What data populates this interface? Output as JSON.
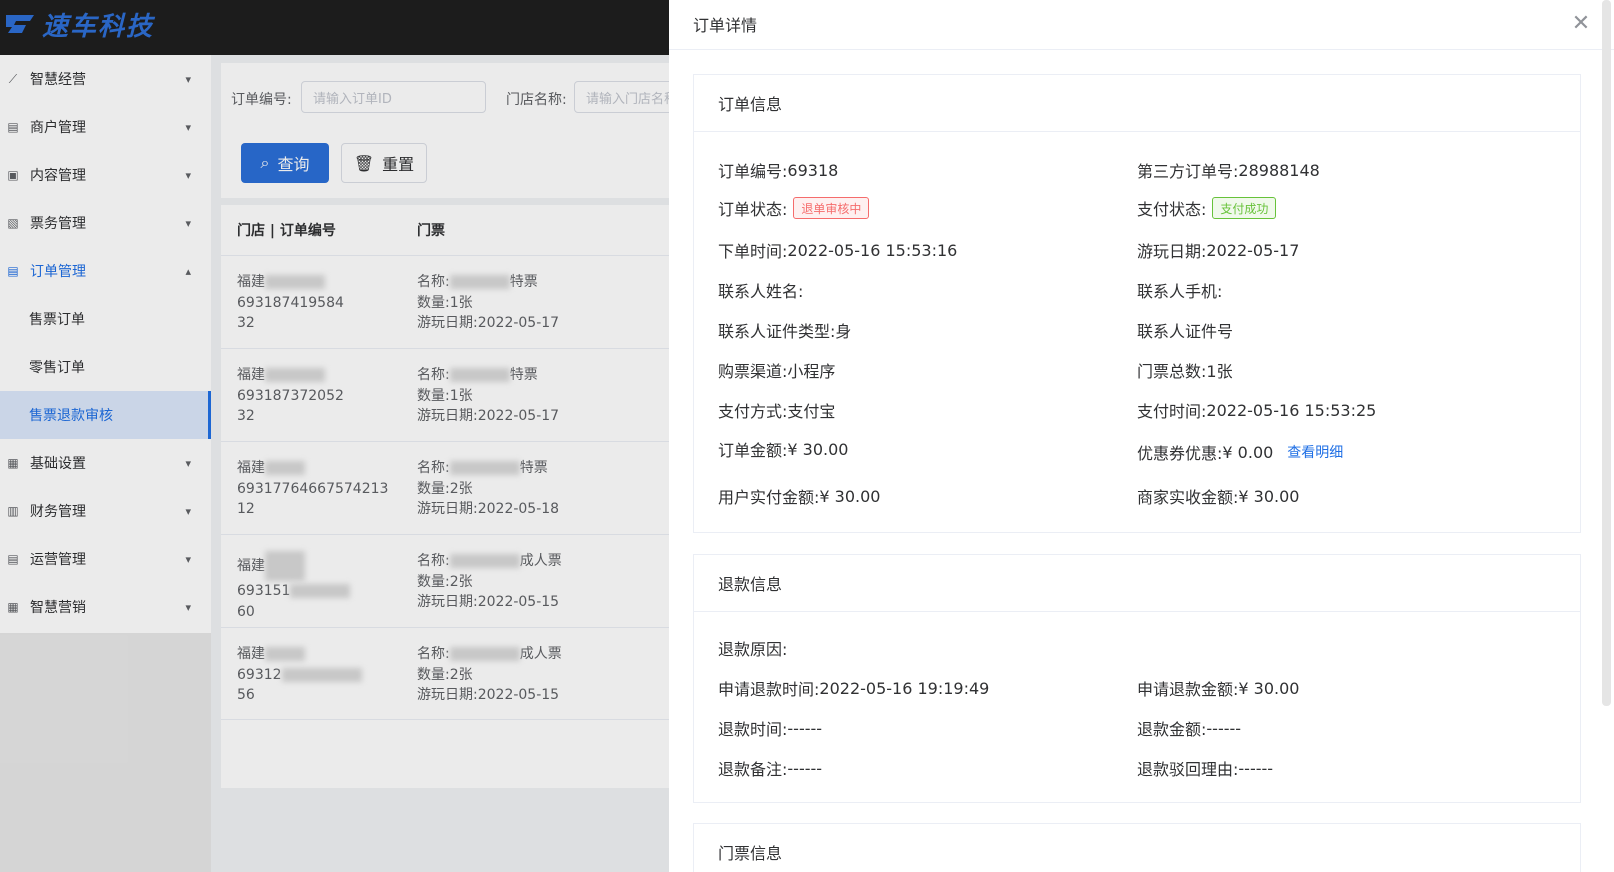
{
  "brand": {
    "logo_text": "速车科技"
  },
  "sidebar": {
    "items": [
      {
        "label": "智慧经营",
        "icon": "chart-line-icon",
        "chevron": "⌄"
      },
      {
        "label": "商户管理",
        "icon": "list-icon",
        "chevron": "⌄"
      },
      {
        "label": "内容管理",
        "icon": "document-icon",
        "chevron": "⌄"
      },
      {
        "label": "票务管理",
        "icon": "ticket-icon",
        "chevron": "⌄"
      },
      {
        "label": "订单管理",
        "icon": "order-icon",
        "chevron": "⌃"
      }
    ],
    "sub_items": [
      "售票订单",
      "零售订单",
      "售票退款审核"
    ],
    "items_after": [
      {
        "label": "基础设置",
        "icon": "settings-icon"
      },
      {
        "label": "财务管理",
        "icon": "bar-chart-icon"
      },
      {
        "label": "运营管理",
        "icon": "clipboard-icon"
      },
      {
        "label": "智慧营销",
        "icon": "grid-icon"
      }
    ]
  },
  "filters": {
    "order_no_label": "订单编号:",
    "order_no_placeholder": "请输入订单ID",
    "store_label": "门店名称:",
    "store_placeholder": "请输入门店名称",
    "query_button": "查询",
    "reset_button": "重置"
  },
  "table": {
    "headers": [
      "门店 | 订单编号",
      "门票"
    ],
    "rows": [
      {
        "store": "福建",
        "order_no_line1": "693187419584",
        "order_no_line2": "32",
        "name": "名称:",
        "name_suffix": "特票",
        "qty": "数量:1张",
        "date": "游玩日期:2022-05-17"
      },
      {
        "store": "福建",
        "order_no_line1": "693187372052",
        "order_no_line2": "32",
        "name": "名称:",
        "name_suffix": "特票",
        "qty": "数量:1张",
        "date": "游玩日期:2022-05-17"
      },
      {
        "store": "福建",
        "order_no_line1": "69317764667574213",
        "order_no_line2": "12",
        "name": "名称:",
        "name_suffix": "特票",
        "qty": "数量:2张",
        "date": "游玩日期:2022-05-18"
      },
      {
        "store": "福建",
        "order_no_line1": "693151",
        "order_no_line2": "60",
        "name": "名称:",
        "name_suffix": "成人票",
        "qty": "数量:2张",
        "date": "游玩日期:2022-05-15"
      },
      {
        "store": "福建",
        "order_no_line1": "69312",
        "order_no_line2": "56",
        "name": "名称:",
        "name_suffix": "成人票",
        "qty": "数量:2张",
        "date": "游玩日期:2022-05-15"
      }
    ]
  },
  "drawer": {
    "title": "订单详情",
    "order_info": {
      "title": "订单信息",
      "order_no_key": "订单编号:",
      "order_no": "69318",
      "third_no_key": "第三方订单号:",
      "third_no": "28988148",
      "order_status_key": "订单状态:",
      "order_status": "退单审核中",
      "pay_status_key": "支付状态:",
      "pay_status": "支付成功",
      "order_time_key": "下单时间:",
      "order_time": "2022-05-16 15:53:16",
      "play_date_key": "游玩日期:",
      "play_date": "2022-05-17",
      "contact_name_key": "联系人姓名:",
      "contact_phone_key": "联系人手机:",
      "id_type_key": "联系人证件类型:",
      "id_type": "身",
      "id_no_key": "联系人证件号",
      "channel_key": "购票渠道:",
      "channel": "小程序",
      "total_tickets_key": "门票总数:",
      "total_tickets": "1张",
      "pay_method_key": "支付方式:",
      "pay_method": "支付宝",
      "pay_time_key": "支付时间:",
      "pay_time": "2022-05-16 15:53:25",
      "amount_key": "订单金额:",
      "amount": "¥ 30.00",
      "coupon_key": "优惠券优惠:",
      "coupon": "¥ 0.00",
      "coupon_link": "查看明细",
      "paid_key": "用户实付金额:",
      "paid": "¥ 30.00",
      "received_key": "商家实收金额:",
      "received": "¥ 30.00"
    },
    "refund_info": {
      "title": "退款信息",
      "reason_key": "退款原因:",
      "apply_time_key": "申请退款时间:",
      "apply_time": "2022-05-16 19:19:49",
      "apply_amount_key": "申请退款金额:",
      "apply_amount": "¥ 30.00",
      "refund_time_key": "退款时间:",
      "refund_time": "------",
      "refund_amount_key": "退款金额:",
      "refund_amount": "------",
      "remark_key": "退款备注:",
      "remark": "------",
      "reject_key": "退款驳回理由:",
      "reject": "------"
    },
    "ticket_info": {
      "title": "门票信息"
    }
  }
}
